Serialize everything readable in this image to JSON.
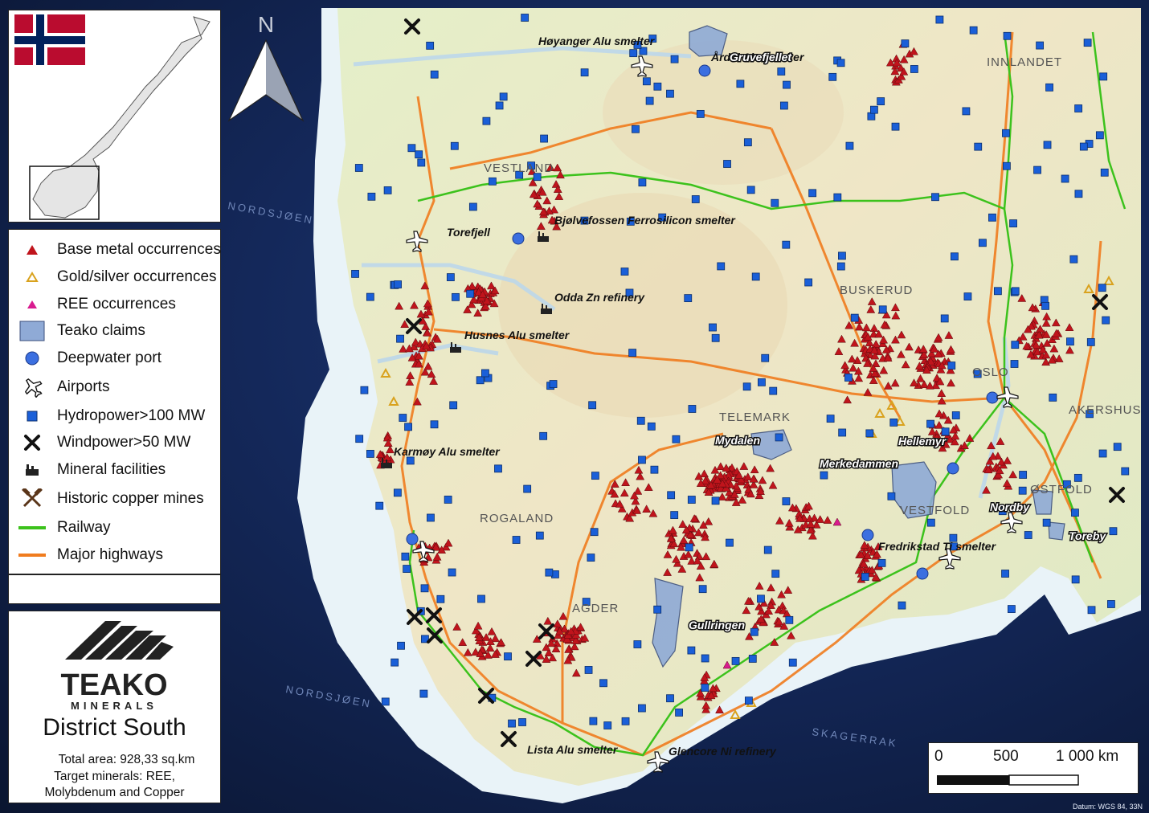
{
  "map": {
    "north_label": "N",
    "sea_labels": [
      "NORDSJØEN",
      "NORDSJØEN",
      "SKAGERRAK"
    ],
    "region_labels": [
      "VESTLAND",
      "ROGALAND",
      "AGDER",
      "TELEMARK",
      "BUSKERUD",
      "INNLANDET",
      "AKERSHUS",
      "OSLO",
      "ØSTFOLD",
      "VESTFOLD"
    ],
    "facility_labels": [
      "Høyanger Alu smelter",
      "Årdal Alu smelter",
      "Torefjell",
      "Bjølvefossen Ferrosilicon smelter",
      "Odda Zn refinery",
      "Husnes Alu smelter",
      "Karmøy Alu smelter",
      "Lista Alu smelter",
      "Glencore Ni refinery",
      "Fredrikstad Ti smelter"
    ],
    "claim_labels": [
      "Gruvefjellet",
      "Mydalen",
      "Hellemyr",
      "Merkedammen",
      "Gullringen",
      "Nordby",
      "Toreby"
    ],
    "colors": {
      "base_metal": "#c0141c",
      "gold_silver": "#d9a21e",
      "ree": "#d81b8f",
      "claims": "#8faad6",
      "port": "#3b6fe0",
      "hydro": "#1a5fd8",
      "railway": "#3cc21c",
      "highway": "#f07c1e"
    }
  },
  "legend": {
    "items": [
      {
        "label": "Base metal occurrences",
        "icon": "red-triangle-icon"
      },
      {
        "label": "Gold/silver occurrences",
        "icon": "gold-triangle-icon"
      },
      {
        "label": "REE occurrences",
        "icon": "magenta-triangle-icon"
      },
      {
        "label": "Teako claims",
        "icon": "claim-square-icon"
      },
      {
        "label": "Deepwater port",
        "icon": "port-circle-icon"
      },
      {
        "label": "Airports",
        "icon": "airplane-icon"
      },
      {
        "label": "Hydropower>100 MW",
        "icon": "hydro-square-icon"
      },
      {
        "label": "Windpower>50 MW",
        "icon": "wind-cross-icon"
      },
      {
        "label": "Mineral facilities",
        "icon": "factory-icon"
      },
      {
        "label": "Historic copper mines",
        "icon": "crossed-hammers-icon"
      },
      {
        "label": "Railway",
        "icon": "railway-line-icon"
      },
      {
        "label": "Major highways",
        "icon": "highway-line-icon"
      }
    ]
  },
  "brand": {
    "company": "TEAKO",
    "sub": "MINERALS",
    "title": "District South",
    "total_area": "Total area: 928,33 sq.km",
    "targets_1": "Target minerals: REE,",
    "targets_2": "Molybdenum and Copper"
  },
  "scale": {
    "label_0": "0",
    "label_500": "500",
    "label_1000": "1 000 km"
  },
  "datum": "Datum: WGS 84, 33N"
}
